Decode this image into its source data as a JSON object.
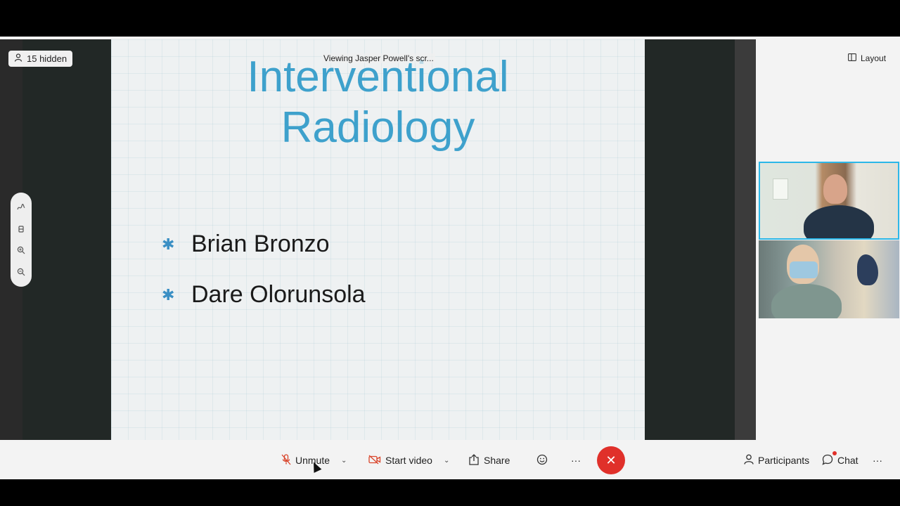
{
  "meeting": {
    "hidden_label": "15 hidden",
    "viewing_label": "Viewing Jasper Powell's scr...",
    "layout_label": "Layout"
  },
  "slide": {
    "title_line1": "Interventional",
    "title_line2": "Radiology",
    "bullets": [
      "Brian Bronzo",
      "Dare Olorunsola"
    ]
  },
  "annotation_tools": [
    "pen-icon",
    "eraser-icon",
    "zoom-in-icon",
    "zoom-out-icon"
  ],
  "toolbar": {
    "unmute_label": "Unmute",
    "video_label": "Start video",
    "share_label": "Share",
    "more_label": "···",
    "participants_label": "Participants",
    "chat_label": "Chat",
    "overflow_label": "···"
  },
  "colors": {
    "slide_title": "#3ea1cc",
    "active_speaker_border": "#2cb7e8",
    "end_call": "#e0302a",
    "muted_icon": "#d9452b"
  }
}
